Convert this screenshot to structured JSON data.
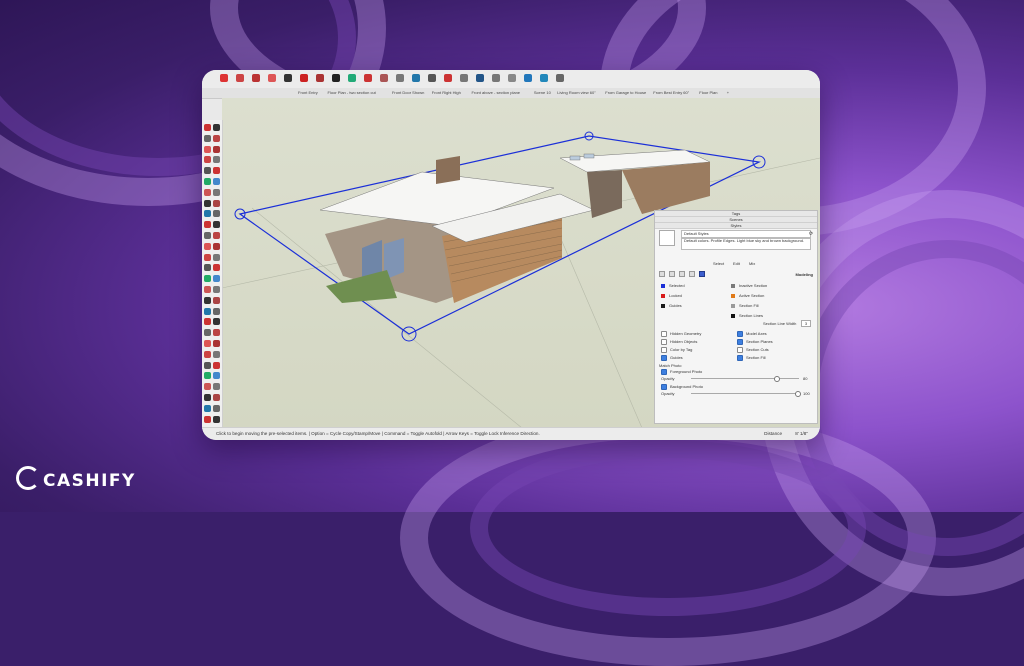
{
  "brand": {
    "logo_text": "CASHIFY"
  },
  "colors": {
    "background_purple": "#5b2f97",
    "accent_blue": "#1b2fd8",
    "viewport": "#d8dbc8"
  },
  "scenes": [
    "Front Entry",
    "Floor Plan - two section cut",
    "Front Door Shown",
    "Front Right High",
    "Front above - section plane",
    "Scene 10",
    "Living Room view 60\"",
    "From Garage to House",
    "From Best Entry 60\"",
    "Floor Plan",
    "+"
  ],
  "toolbar_icons": [
    "select-icon",
    "eraser-icon",
    "pencil-icon",
    "arc-icon",
    "rectangle-icon",
    "circle-icon",
    "pushpull-icon",
    "move-icon",
    "rotate-icon",
    "scale-icon",
    "offset-icon",
    "tape-icon",
    "paint-icon",
    "orbit-icon",
    "pan-icon",
    "zoom-icon",
    "zoom-extents-icon",
    "walk-icon",
    "section-icon",
    "scene-icon",
    "layer-icon",
    "camera-icon"
  ],
  "status": {
    "message": "Click to begin moving the pre-selected items. | Option = Cycle Copy/Stamp/Move | Command = Toggle Autofold | Arrow Keys = Toggle Lock Inference Direction.",
    "distance_label": "Distance",
    "distance_value": "8' 1/8\""
  },
  "panel": {
    "tabs": [
      "Tags",
      "Scenes",
      "Styles"
    ],
    "style_name": "Default Styles",
    "style_desc": "Default colors. Profile Edges. Light blue sky and brown background.",
    "mode_tabs": [
      "Select",
      "Edit",
      "Mix"
    ],
    "section_title": "Modeling",
    "colors_left": [
      {
        "label": "Selected",
        "color": "#1b2fd8"
      },
      {
        "label": "Locked",
        "color": "#d81b1b"
      },
      {
        "label": "Guides",
        "color": "#1a1a1a"
      }
    ],
    "colors_right": [
      {
        "label": "Inactive Section",
        "color": "#7a7a7a"
      },
      {
        "label": "Active Section",
        "color": "#e07a18"
      },
      {
        "label": "Section Fill",
        "color": "#9a9a9a"
      },
      {
        "label": "Section Lines",
        "color": "#111111"
      }
    ],
    "line_width_label": "Section Line Width",
    "line_width_value": "3",
    "checks_left": [
      {
        "label": "Hidden Geometry",
        "on": false
      },
      {
        "label": "Hidden Objects",
        "on": false
      },
      {
        "label": "Color by Tag",
        "on": false
      },
      {
        "label": "Guides",
        "on": true
      }
    ],
    "checks_right": [
      {
        "label": "Model Axes",
        "on": true
      },
      {
        "label": "Section Planes",
        "on": true
      },
      {
        "label": "Section Cuts",
        "on": false
      },
      {
        "label": "Section Fill",
        "on": true
      }
    ],
    "match_photo": "Match Photo",
    "fg_photo": "Foreground Photo",
    "bg_photo": "Background Photo",
    "opacity_label": "Opacity",
    "fg_opacity": 0.8,
    "bg_opacity": 1.0,
    "fg_value": "80",
    "bg_value": "100"
  }
}
